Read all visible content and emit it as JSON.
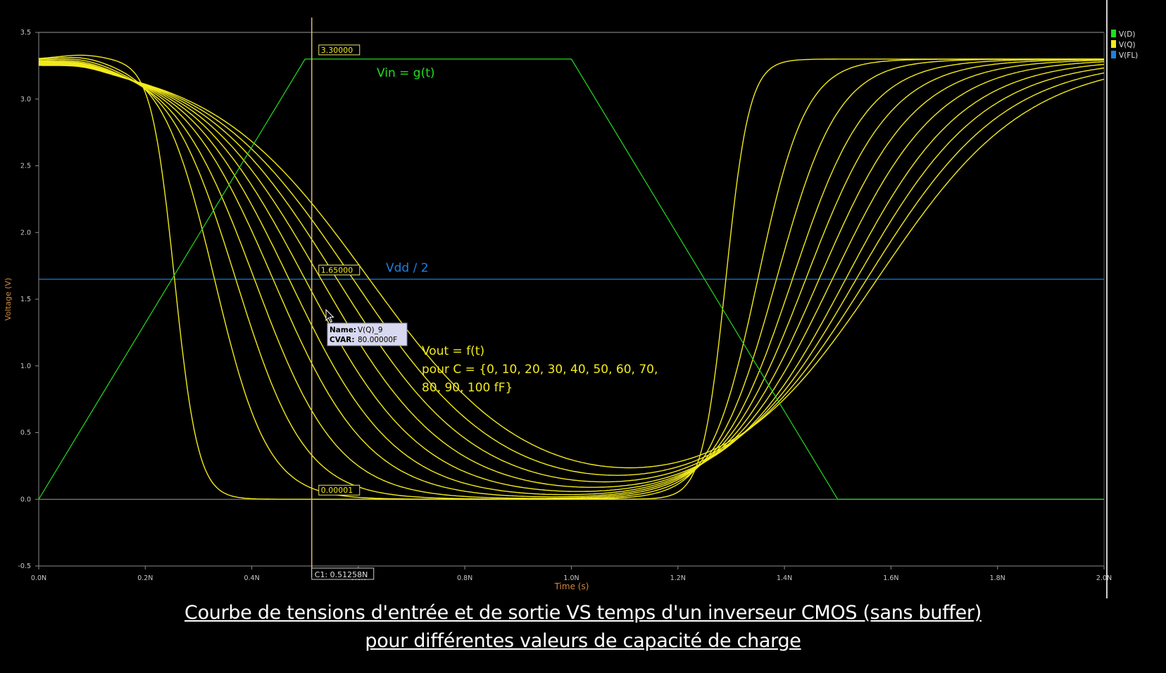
{
  "chart_data": {
    "type": "line",
    "ylabel": "Voltage (V)",
    "xlabel": "Time (s)",
    "xlim": [
      0,
      2.0
    ],
    "ylim": [
      -0.5,
      3.5
    ],
    "x_unit": "ns",
    "x_ticks": [
      0,
      0.2,
      0.4,
      0.6,
      0.8,
      1.0,
      1.2,
      1.4,
      1.6,
      1.8,
      2.0
    ],
    "x_tick_labels": [
      "0.0N",
      "0.2N",
      "0.4N",
      "0.6N",
      "0.8N",
      "1.0N",
      "1.2N",
      "1.4N",
      "1.6N",
      "1.8N",
      "2.0N"
    ],
    "y_ticks": [
      -0.5,
      0.0,
      0.5,
      1.0,
      1.5,
      2.0,
      2.5,
      3.0,
      3.5
    ],
    "y_tick_labels": [
      "-0.5",
      "0.0",
      "0.5",
      "1.0",
      "1.5",
      "2.0",
      "2.5",
      "3.0",
      "3.5"
    ],
    "legend": [
      {
        "label": "V(D)",
        "color": "#22dd22"
      },
      {
        "label": "V(Q)",
        "color": "#f2ea1c"
      },
      {
        "label": "V(FL)",
        "color": "#1e7fe0"
      }
    ],
    "series": [
      {
        "name": "V(D)",
        "color": "#22dd22",
        "x": [
          0,
          0.5,
          1.0,
          1.5,
          2.0
        ],
        "y": [
          0,
          3.3,
          3.3,
          0,
          0
        ]
      },
      {
        "name": "V(FL)",
        "color": "#1e7fe0",
        "x": [
          0,
          2.0
        ],
        "y": [
          1.65,
          1.65
        ]
      },
      {
        "name": "V(Q)",
        "color": "#f2ea1c",
        "family": {
          "capacitance_fF": [
            0,
            10,
            20,
            30,
            40,
            50,
            60,
            70,
            80,
            90,
            100
          ],
          "fall_mid_ns": [
            0.255,
            0.33,
            0.37,
            0.405,
            0.44,
            0.47,
            0.5,
            0.53,
            0.56,
            0.59,
            0.62
          ],
          "fall_width_ns": [
            0.022,
            0.05,
            0.065,
            0.078,
            0.09,
            0.1,
            0.11,
            0.12,
            0.13,
            0.14,
            0.15
          ],
          "rise_mid_ns": [
            1.29,
            1.35,
            1.385,
            1.415,
            1.44,
            1.465,
            1.49,
            1.515,
            1.535,
            1.555,
            1.575
          ],
          "rise_width_ns": [
            0.022,
            0.045,
            0.058,
            0.07,
            0.08,
            0.09,
            0.1,
            0.11,
            0.12,
            0.13,
            0.14
          ]
        }
      }
    ],
    "cursor": {
      "label": "C1: 0.51258N",
      "x": 0.51258
    },
    "cursor_values": [
      "3.30000",
      "1.65000",
      "0.00001"
    ],
    "tooltip": {
      "name_key": "Name:",
      "name_value": "V(Q)_9",
      "cvar_key": "CVAR:",
      "cvar_value": "80.00000F"
    },
    "annotations": {
      "vin": "Vin = g(t)",
      "vdd": "Vdd / 2",
      "vout_1": "Vout = f(t)",
      "vout_2": "pour C = {0, 10, 20, 30, 40, 50, 60, 70,",
      "vout_3": "80, 90, 100 fF}"
    }
  },
  "caption": {
    "line1": "Courbe de tensions d'entrée et de sortie VS temps d'un inverseur CMOS (sans buffer)",
    "line2": "pour différentes valeurs de capacité de charge"
  }
}
